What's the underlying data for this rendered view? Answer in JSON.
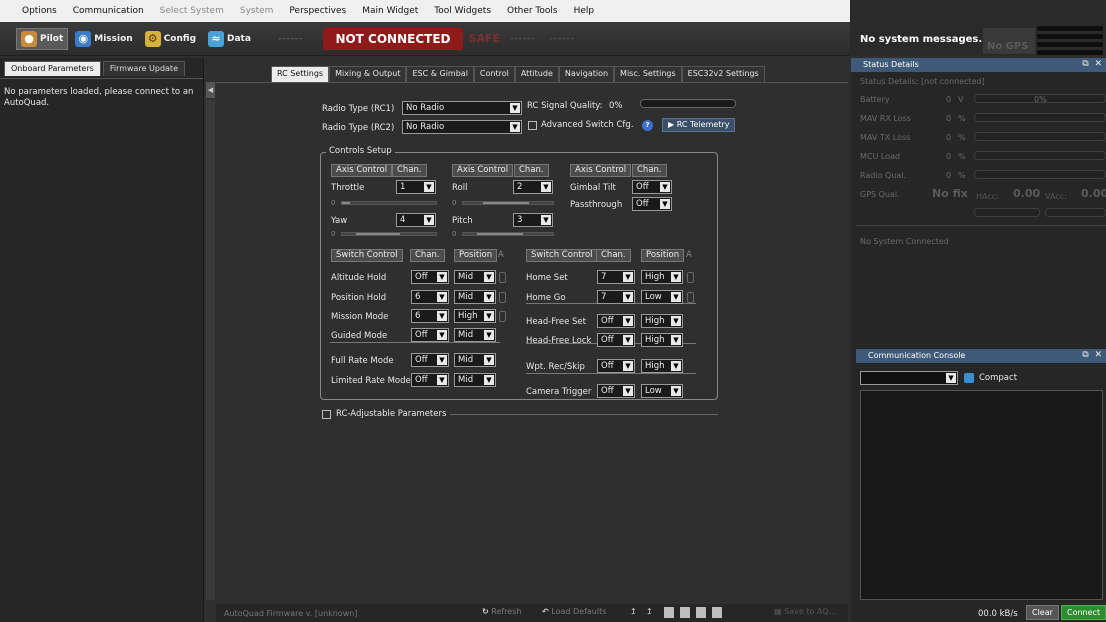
{
  "menu": [
    "Options",
    "Communication",
    "Select System",
    "System",
    "Perspectives",
    "Main Widget",
    "Tool Widgets",
    "Other Tools",
    "Help"
  ],
  "menu_dim": [
    false,
    false,
    true,
    true,
    false,
    false,
    false,
    false,
    false
  ],
  "toolbar": {
    "pilot": "Pilot",
    "mission": "Mission",
    "config": "Config",
    "data": "Data",
    "sep1": "------",
    "not_connected": "NOT CONNECTED",
    "safe": "SAFE",
    "dash1": "------",
    "dash2": "------"
  },
  "status_strip": {
    "messages": "No system messages.",
    "gps": "No GPS"
  },
  "left_panel": {
    "tabs": [
      "Onboard Parameters",
      "Firmware Update"
    ],
    "message": "No parameters loaded, please connect to an AutoQuad."
  },
  "center_tabs": [
    "RC Settings",
    "Mixing & Output",
    "ESC & Gimbal",
    "Control",
    "Attitude",
    "Navigation",
    "Misc. Settings",
    "ESC32v2 Settings"
  ],
  "radio": {
    "rc1_label": "Radio Type (RC1)",
    "rc1_value": "No Radio",
    "rc2_label": "Radio Type (RC2)",
    "rc2_value": "No Radio",
    "signal_label": "RC Signal Quality:",
    "signal_value": "0%",
    "advanced_label": "Advanced Switch Cfg.",
    "help": "?",
    "telemetry": "RC Telemetry"
  },
  "controls": {
    "title": "Controls Setup",
    "axis_header": "Axis Control",
    "chan_header": "Chan.",
    "switch_header": "Switch Control",
    "position_header": "Position",
    "a_header": "A",
    "zero": "0",
    "throttle": {
      "label": "Throttle",
      "chan": "1"
    },
    "roll": {
      "label": "Roll",
      "chan": "2"
    },
    "yaw": {
      "label": "Yaw",
      "chan": "4"
    },
    "pitch": {
      "label": "Pitch",
      "chan": "3"
    },
    "gimbal_tilt": {
      "label": "Gimbal Tilt",
      "chan": "Off"
    },
    "passthrough": {
      "label": "Passthrough",
      "chan": "Off"
    },
    "left_switches": [
      {
        "label": "Altitude Hold",
        "chan": "Off",
        "pos": "Mid"
      },
      {
        "label": "Position Hold",
        "chan": "6",
        "pos": "Mid"
      },
      {
        "label": "Mission Mode",
        "chan": "6",
        "pos": "High"
      },
      {
        "label": "Guided Mode",
        "chan": "Off",
        "pos": "Mid"
      },
      {
        "label": "Full Rate Mode",
        "chan": "Off",
        "pos": "Mid"
      },
      {
        "label": "Limited Rate Mode",
        "chan": "Off",
        "pos": "Mid"
      }
    ],
    "right_switches": [
      {
        "label": "Home Set",
        "chan": "7",
        "pos": "High"
      },
      {
        "label": "Home Go",
        "chan": "7",
        "pos": "Low"
      },
      {
        "label": "Head-Free Set",
        "chan": "Off",
        "pos": "High"
      },
      {
        "label": "Head-Free Lock",
        "chan": "Off",
        "pos": "High"
      },
      {
        "label": "Wpt. Rec/Skip",
        "chan": "Off",
        "pos": "High"
      },
      {
        "label": "Camera Trigger",
        "chan": "Off",
        "pos": "Low"
      }
    ]
  },
  "rc_adjustable": "RC-Adjustable Parameters",
  "bottom": {
    "firmware": "AutoQuad Firmware v. [unknown]",
    "refresh": "Refresh",
    "load_defaults": "Load Defaults",
    "save": "Save to AQ..."
  },
  "status_details": {
    "title": "Status Details",
    "sub": "Status Details: [not connected]",
    "battery": {
      "label": "Battery",
      "value": "0",
      "unit": "V",
      "pct": "0%"
    },
    "mav_rx": {
      "label": "MAV RX Loss",
      "value": "0",
      "unit": "%"
    },
    "mav_tx": {
      "label": "MAV TX Loss",
      "value": "0",
      "unit": "%"
    },
    "mcu": {
      "label": "MCU Load",
      "value": "0",
      "unit": "%"
    },
    "radio": {
      "label": "Radio Qual.",
      "value": "0",
      "unit": "%"
    },
    "gps_label": "GPS Qual.",
    "gps_fix": "No fix",
    "hacc_label": "HAcc:",
    "hacc_value": "0.00",
    "vacc_label": "VAcc:",
    "vacc_value": "0.00",
    "no_system": "No System Connected"
  },
  "console": {
    "title": "Communication Console",
    "compact": "Compact",
    "rate": "00.0 kB/s",
    "clear": "Clear",
    "connect": "Connect"
  },
  "colors": {
    "not_connected_bg": "#8e1a1a",
    "panel_title": "#3f5a78",
    "connect": "#2e8b2e"
  }
}
